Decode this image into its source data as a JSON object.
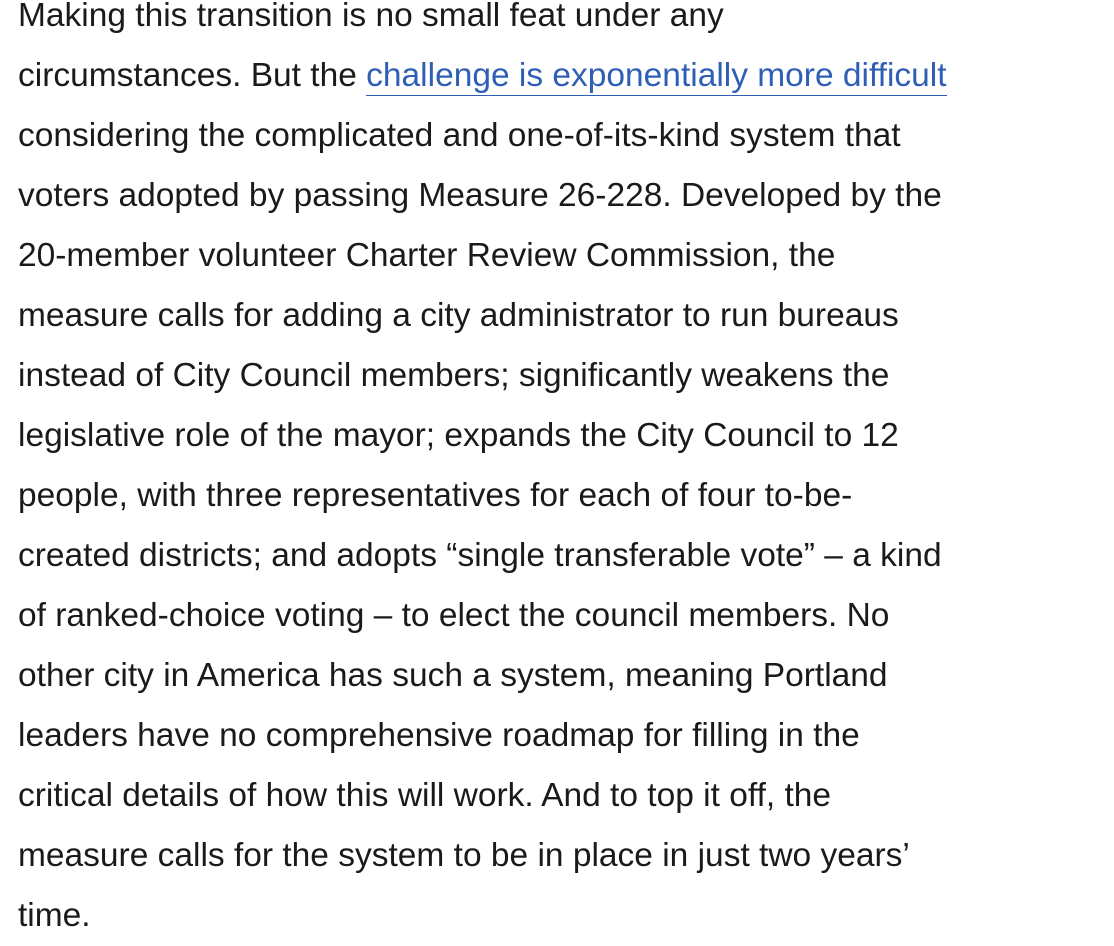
{
  "paragraph": {
    "lines": [
      "Making this transition is no small feat under any",
      "circumstances. But the ",
      "considering the complicated and one-of-its-kind system that",
      "voters adopted by passing Measure 26-228. Developed by the",
      "20-member volunteer Charter Review Commission, the",
      "measure calls for adding a city administrator to run bureaus",
      "instead of City Council members; significantly weakens the",
      "legislative role of the mayor; expands the City Council to 12",
      "people, with three representatives for each of four to-be-",
      "created districts; and adopts “single transferable vote” – a kind",
      "of ranked-choice voting – to elect the council members. No",
      "other city in America has such a system, meaning Portland",
      "leaders have no comprehensive roadmap for filling in the",
      "critical details of how this will work. And to top it off, the",
      "measure calls for the system to be in place in just two years’",
      "time."
    ],
    "link_text": "challenge is exponentially more difficult",
    "link_color": "#2f5fb5",
    "text_color": "#1a1a1a"
  }
}
